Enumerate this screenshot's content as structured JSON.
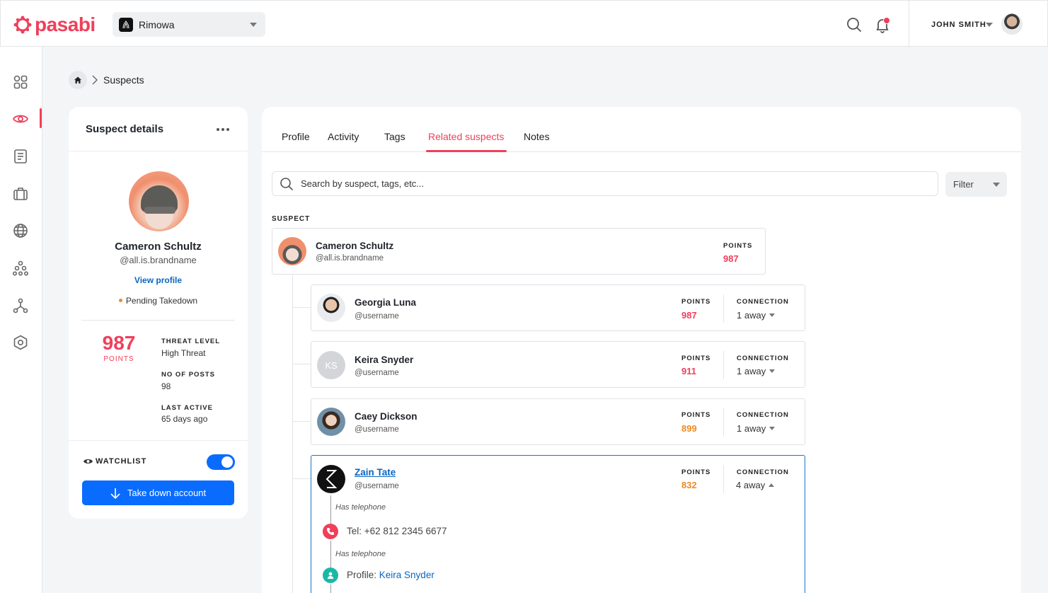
{
  "header": {
    "logo": "pasabi",
    "brand_select": "Rimowa",
    "user_name": "JOHN SMITH"
  },
  "breadcrumb": {
    "current": "Suspects"
  },
  "detail_card": {
    "title": "Suspect details",
    "name": "Cameron Schultz",
    "handle": "@all.is.brandname",
    "view_profile": "View profile",
    "status": "Pending Takedown",
    "points": "987",
    "points_label": "POINTS",
    "threat_label": "THREAT LEVEL",
    "threat_value": "High Threat",
    "posts_label": "NO OF POSTS",
    "posts_value": "98",
    "active_label": "LAST ACTIVE",
    "active_value": "65 days ago",
    "watchlist_label": "WATCHLIST",
    "watchlist_on": true,
    "takedown_label": "Take down account"
  },
  "tabs": [
    {
      "label": "Profile"
    },
    {
      "label": "Activity"
    },
    {
      "label": "Tags"
    },
    {
      "label": "Related suspects"
    },
    {
      "label": "Notes"
    }
  ],
  "active_tab": "Related suspects",
  "search": {
    "placeholder": "Search by suspect, tags, etc...",
    "value": ""
  },
  "filter_label": "Filter",
  "suspect_section_label": "SUSPECT",
  "columns": {
    "points": "POINTS",
    "connection": "CONNECTION"
  },
  "root_suspect": {
    "name": "Cameron Schultz",
    "handle": "@all.is.brandname",
    "points": "987"
  },
  "related": [
    {
      "name": "Georgia Luna",
      "handle": "@username",
      "points": "987",
      "points_color": "red",
      "connection": "1 away"
    },
    {
      "name": "Keira Snyder",
      "handle": "@username",
      "points": "911",
      "points_color": "red",
      "connection": "1 away",
      "initials": "KS"
    },
    {
      "name": "Caey Dickson",
      "handle": "@username",
      "points": "899",
      "points_color": "orange",
      "connection": "1 away"
    },
    {
      "name": "Zain Tate",
      "handle": "@username",
      "points": "832",
      "points_color": "orange",
      "connection": "4 away",
      "expanded": true
    }
  ],
  "expanded_path": [
    {
      "relation": "Has telephone",
      "prefix": "Tel: ",
      "value": "+62 812  2345 6677"
    },
    {
      "relation": "Has telephone",
      "prefix": "Profile: ",
      "value": "Keira Snyder"
    }
  ],
  "colors": {
    "accent": "#ef3f5a",
    "primary": "#0a6cff",
    "orange": "#f08a24",
    "link": "#0a66c2"
  }
}
